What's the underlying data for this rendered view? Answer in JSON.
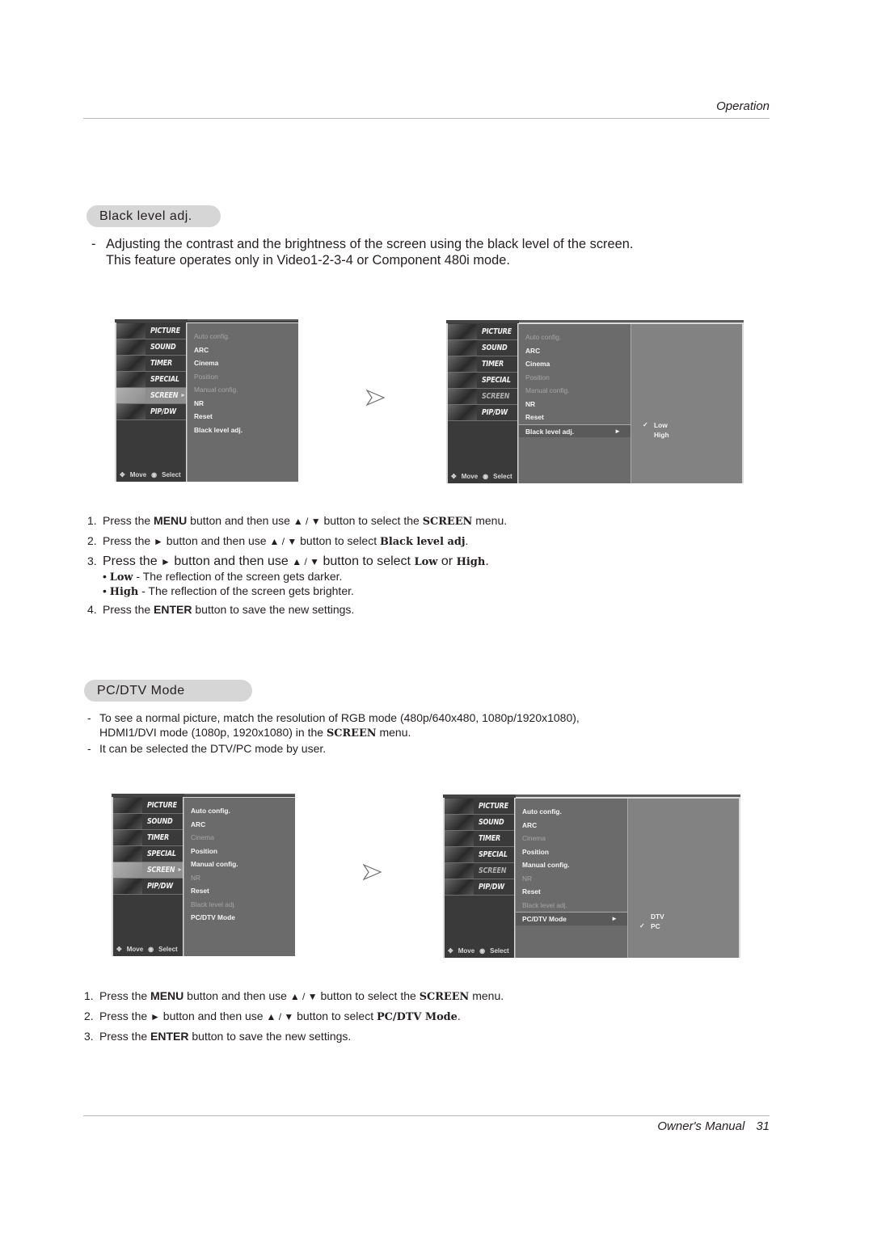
{
  "header": {
    "section": "Operation"
  },
  "footer": {
    "title": "Owner's Manual",
    "page": "31"
  },
  "black_level": {
    "heading": "Black level adj.",
    "description_dash": "-",
    "description_line1": "Adjusting the contrast and the brightness of the screen using the black level of the screen.",
    "description_line2": "This feature operates only in Video1-2-3-4 or Component 480i mode.",
    "osd_left": {
      "side_items": [
        "PICTURE",
        "SOUND",
        "TIMER",
        "SPECIAL",
        "SCREEN",
        "PIP/DW"
      ],
      "active_side": "SCREEN",
      "hint_move": "Move",
      "hint_select": "Select",
      "options": [
        {
          "label": "Auto config.",
          "state": "disabled"
        },
        {
          "label": "ARC",
          "state": "enabled"
        },
        {
          "label": "Cinema",
          "state": "enabled"
        },
        {
          "label": "Position",
          "state": "disabled"
        },
        {
          "label": "Manual config.",
          "state": "disabled"
        },
        {
          "label": "NR",
          "state": "enabled"
        },
        {
          "label": "Reset",
          "state": "enabled"
        },
        {
          "label": "Black level adj.",
          "state": "enabled"
        }
      ]
    },
    "osd_right": {
      "side_items": [
        "PICTURE",
        "SOUND",
        "TIMER",
        "SPECIAL",
        "SCREEN",
        "PIP/DW"
      ],
      "hint_move": "Move",
      "hint_select": "Select",
      "options": [
        {
          "label": "Auto config.",
          "state": "disabled"
        },
        {
          "label": "ARC",
          "state": "enabled"
        },
        {
          "label": "Cinema",
          "state": "enabled"
        },
        {
          "label": "Position",
          "state": "disabled"
        },
        {
          "label": "Manual config.",
          "state": "disabled"
        },
        {
          "label": "NR",
          "state": "enabled"
        },
        {
          "label": "Reset",
          "state": "enabled"
        },
        {
          "label": "Black level adj.",
          "state": "selected"
        }
      ],
      "submenu": [
        {
          "label": "Low",
          "checked": true
        },
        {
          "label": "High",
          "checked": false
        }
      ]
    },
    "steps": {
      "s1": {
        "num": "1.",
        "a": "Press the ",
        "b1": "MENU",
        "c": " button and then use ",
        "arrows": "▲ / ▼",
        "d": " button to select the ",
        "b2": "SCREEN",
        "e": " menu."
      },
      "s2": {
        "num": "2.",
        "a": "Press the ",
        "right": "►",
        "c": " button and then use ",
        "arrows": "▲ / ▼",
        "d": " button to select ",
        "b2": "Black level adj",
        "e": "."
      },
      "s3": {
        "num": "3.",
        "a": "Press the ",
        "right": "►",
        "c": "  button and then use ",
        "arrows": "▲ / ▼",
        "d": " button to select  ",
        "b2": "Low",
        "or": " or ",
        "b3": "High",
        "e": "."
      },
      "bullet_low": {
        "bullet": "•",
        "term": "Low",
        "text": " - The reflection of the screen gets darker."
      },
      "bullet_high": {
        "bullet": "•",
        "term": "High",
        "text": " - The reflection of the screen gets brighter."
      },
      "s4": {
        "num": "4.",
        "a": "Press the ",
        "b1": "ENTER",
        "c": " button to save the new settings."
      }
    }
  },
  "pc_dtv": {
    "heading": "PC/DTV Mode",
    "desc1_line1": "To see a normal picture, match the resolution of RGB mode (480p/640x480, 1080p/1920x1080),",
    "desc1_line2a": "HDMI1/DVI mode (1080p, 1920x1080) in the ",
    "desc1_line2b": "SCREEN",
    "desc1_line2c": " menu.",
    "desc2": "It can be selected the DTV/PC mode by user.",
    "osd_left": {
      "side_items": [
        "PICTURE",
        "SOUND",
        "TIMER",
        "SPECIAL",
        "SCREEN",
        "PIP/DW"
      ],
      "hint_move": "Move",
      "hint_select": "Select",
      "options": [
        {
          "label": "Auto config.",
          "state": "enabled"
        },
        {
          "label": "ARC",
          "state": "enabled"
        },
        {
          "label": "Cinema",
          "state": "disabled"
        },
        {
          "label": "Position",
          "state": "enabled"
        },
        {
          "label": "Manual config.",
          "state": "enabled"
        },
        {
          "label": "NR",
          "state": "disabled"
        },
        {
          "label": "Reset",
          "state": "enabled"
        },
        {
          "label": "Black level adj.",
          "state": "disabled"
        },
        {
          "label": "PC/DTV Mode",
          "state": "enabled"
        }
      ]
    },
    "osd_right": {
      "side_items": [
        "PICTURE",
        "SOUND",
        "TIMER",
        "SPECIAL",
        "SCREEN",
        "PIP/DW"
      ],
      "hint_move": "Move",
      "hint_select": "Select",
      "options": [
        {
          "label": "Auto config.",
          "state": "enabled"
        },
        {
          "label": "ARC",
          "state": "enabled"
        },
        {
          "label": "Cinema",
          "state": "disabled"
        },
        {
          "label": "Position",
          "state": "enabled"
        },
        {
          "label": "Manual config.",
          "state": "enabled"
        },
        {
          "label": "NR",
          "state": "disabled"
        },
        {
          "label": "Reset",
          "state": "enabled"
        },
        {
          "label": "Black level adj.",
          "state": "disabled"
        },
        {
          "label": "PC/DTV Mode",
          "state": "selected"
        }
      ],
      "submenu": [
        {
          "label": "DTV",
          "checked": false
        },
        {
          "label": "PC",
          "checked": true
        }
      ]
    },
    "steps": {
      "s1": {
        "num": "1.",
        "a": "Press the ",
        "b1": "MENU",
        "c": " button and then use ",
        "arrows": "▲ / ▼",
        "d": " button to select the ",
        "b2": "SCREEN",
        "e": " menu."
      },
      "s2": {
        "num": "2.",
        "a": "Press the ",
        "right": "►",
        "c": " button and then use ",
        "arrows": "▲ / ▼",
        "d": " button to select ",
        "b2": "PC/DTV Mode",
        "e": "."
      },
      "s3": {
        "num": "3.",
        "a": "Press the ",
        "b1": "ENTER",
        "c": " button to save the new settings."
      }
    }
  },
  "icons": {
    "next": "hollow-right-arrow",
    "check": "✓",
    "submenu_tri": "►",
    "caret": "►"
  }
}
